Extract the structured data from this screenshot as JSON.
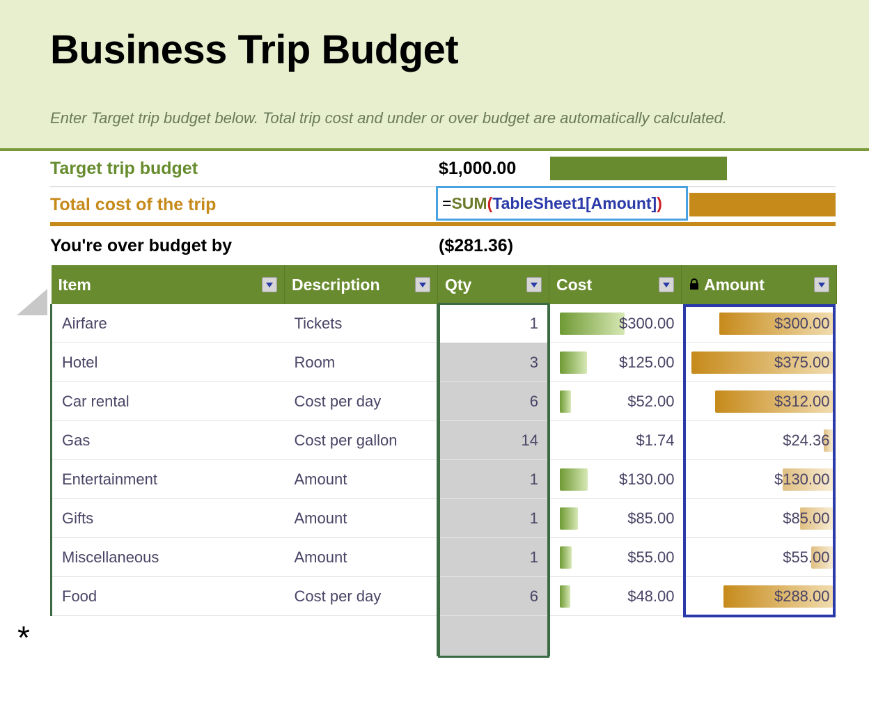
{
  "title": "Business Trip Budget",
  "subtitle": "Enter Target trip budget below. Total trip cost and under or over budget are automatically calculated.",
  "summary": {
    "target_label": "Target trip budget",
    "target_value": "$1,000.00",
    "total_label": "Total cost of the trip",
    "formula_display": {
      "eq": "=",
      "fn": "SUM",
      "open": "(",
      "ref": "TableSheet1[Amount]",
      "close": ")"
    },
    "over_label": "You're over budget by",
    "over_value": "($281.36)"
  },
  "columns": {
    "item": "Item",
    "description": "Description",
    "qty": "Qty",
    "cost": "Cost",
    "amount": "Amount"
  },
  "rows": [
    {
      "item": "Airfare",
      "description": "Tickets",
      "qty": "1",
      "cost": "$300.00",
      "amount": "$300.00",
      "cost_bar": 100,
      "amount_bar": 80,
      "amount_strong": true
    },
    {
      "item": "Hotel",
      "description": "Room",
      "qty": "3",
      "cost": "$125.00",
      "amount": "$375.00",
      "cost_bar": 42,
      "amount_bar": 100,
      "amount_strong": true
    },
    {
      "item": "Car rental",
      "description": "Cost per day",
      "qty": "6",
      "cost": "$52.00",
      "amount": "$312.00",
      "cost_bar": 17,
      "amount_bar": 83,
      "amount_strong": true
    },
    {
      "item": "Gas",
      "description": "Cost per gallon",
      "qty": "14",
      "cost": "$1.74",
      "amount": "$24.36",
      "cost_bar": 0,
      "amount_bar": 6,
      "amount_strong": false
    },
    {
      "item": "Entertainment",
      "description": "Amount",
      "qty": "1",
      "cost": "$130.00",
      "amount": "$130.00",
      "cost_bar": 43,
      "amount_bar": 35,
      "amount_strong": false
    },
    {
      "item": "Gifts",
      "description": "Amount",
      "qty": "1",
      "cost": "$85.00",
      "amount": "$85.00",
      "cost_bar": 28,
      "amount_bar": 23,
      "amount_strong": false
    },
    {
      "item": "Miscellaneous",
      "description": "Amount",
      "qty": "1",
      "cost": "$55.00",
      "amount": "$55.00",
      "cost_bar": 18,
      "amount_bar": 15,
      "amount_strong": false
    },
    {
      "item": "Food",
      "description": "Cost per day",
      "qty": "6",
      "cost": "$48.00",
      "amount": "$288.00",
      "cost_bar": 16,
      "amount_bar": 77,
      "amount_strong": true
    }
  ],
  "new_row_marker": "*",
  "colors": {
    "green": "#698b2f",
    "orange": "#c68a1b",
    "blue_selection": "#2a3aa8",
    "green_selection": "#3a6b42",
    "header_bg": "#e7efce"
  }
}
